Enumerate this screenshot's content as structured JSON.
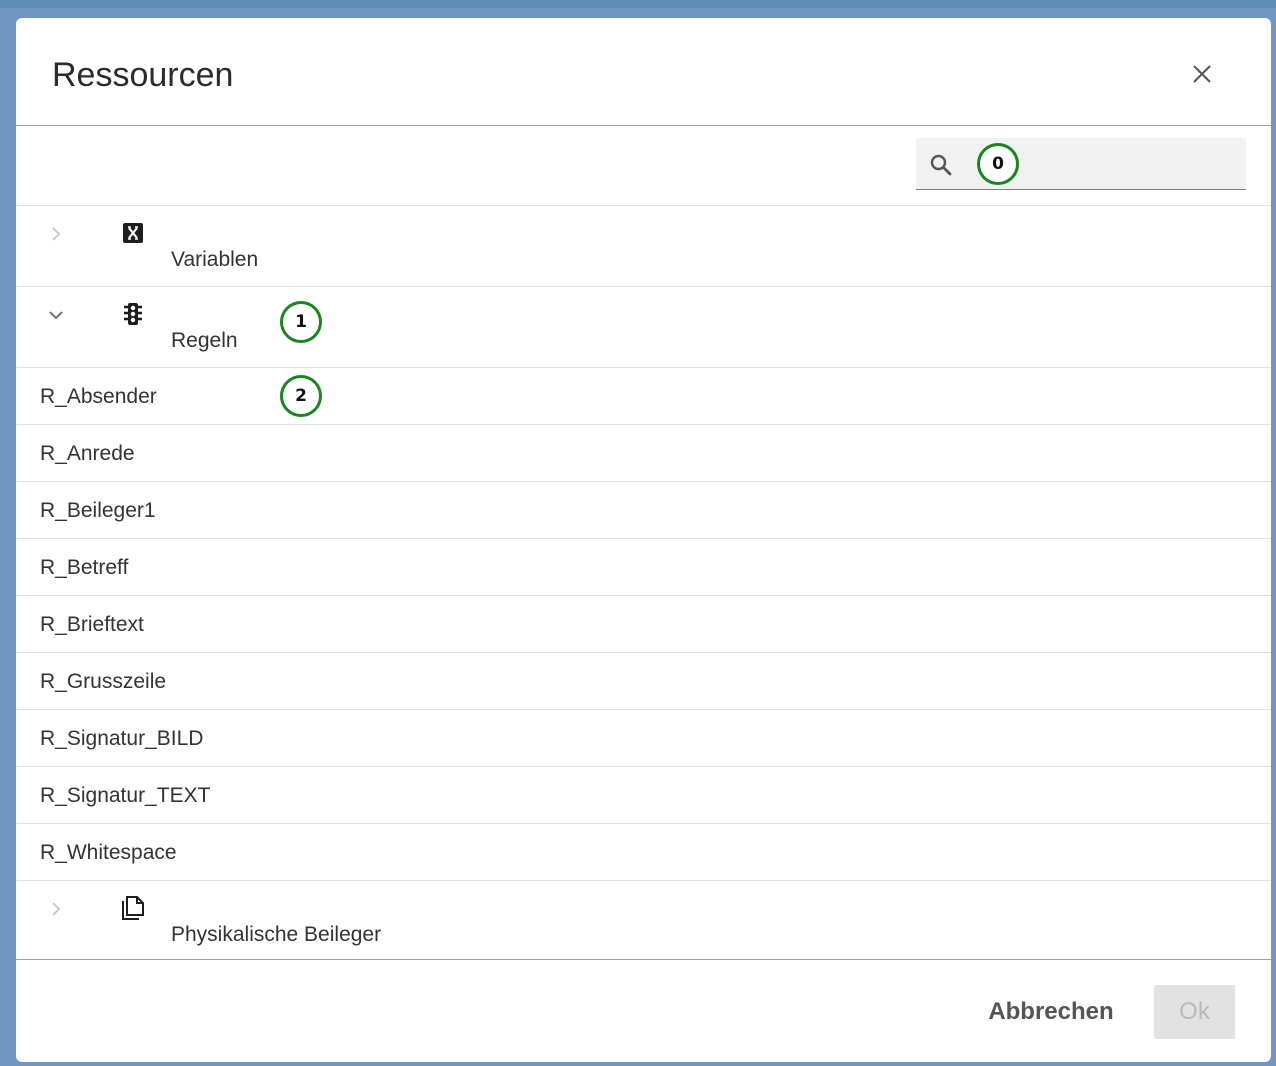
{
  "dialog": {
    "title": "Ressourcen",
    "close_icon": "close-icon"
  },
  "search": {
    "placeholder": "",
    "value": "",
    "icon": "search-icon"
  },
  "markers": {
    "search": "0",
    "regeln": "1",
    "absender": "2",
    "color": "#17871d"
  },
  "tree": {
    "groups": [
      {
        "label": "Variablen",
        "icon": "variable-x-icon",
        "expanded": false
      },
      {
        "label": "Regeln",
        "icon": "traffic-light-icon",
        "expanded": true
      },
      {
        "label": "Physikalische Beileger",
        "icon": "documents-icon",
        "expanded": false
      }
    ],
    "regeln_items": [
      "R_Absender",
      "R_Anrede",
      "R_Beileger1",
      "R_Betreff",
      "R_Brieftext",
      "R_Grusszeile",
      "R_Signatur_BILD",
      "R_Signatur_TEXT",
      "R_Whitespace"
    ]
  },
  "footer": {
    "cancel_label": "Abbrechen",
    "ok_label": "Ok",
    "ok_disabled": true
  }
}
